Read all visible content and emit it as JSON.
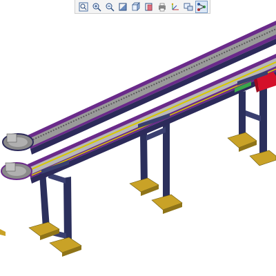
{
  "viewer": {
    "background": "#ffffff",
    "toolbar": [
      {
        "name": "zoom-fit-icon",
        "tooltip": ""
      },
      {
        "name": "zoom-in-icon",
        "tooltip": ""
      },
      {
        "name": "zoom-out-icon",
        "tooltip": ""
      },
      {
        "name": "shading-icon",
        "tooltip": ""
      },
      {
        "name": "view-cube-icon",
        "tooltip": ""
      },
      {
        "name": "hidden-lines-icon",
        "tooltip": ""
      },
      {
        "name": "print-icon",
        "tooltip": ""
      },
      {
        "name": "axis-icon",
        "tooltip": ""
      },
      {
        "name": "section-icon",
        "tooltip": ""
      },
      {
        "name": "tree-icon",
        "tooltip": "",
        "active": true
      }
    ]
  },
  "colors": {
    "frame_dark": "#2c2a5a",
    "frame_purple": "#6a2a8a",
    "belt_grey": "#9a9a9a",
    "rail_yellow": "#d8c800",
    "rail_green": "#3aa64a",
    "foot_gold": "#c9a227",
    "leg_navy": "#2b2f5c",
    "motor_red": "#d4102a"
  }
}
